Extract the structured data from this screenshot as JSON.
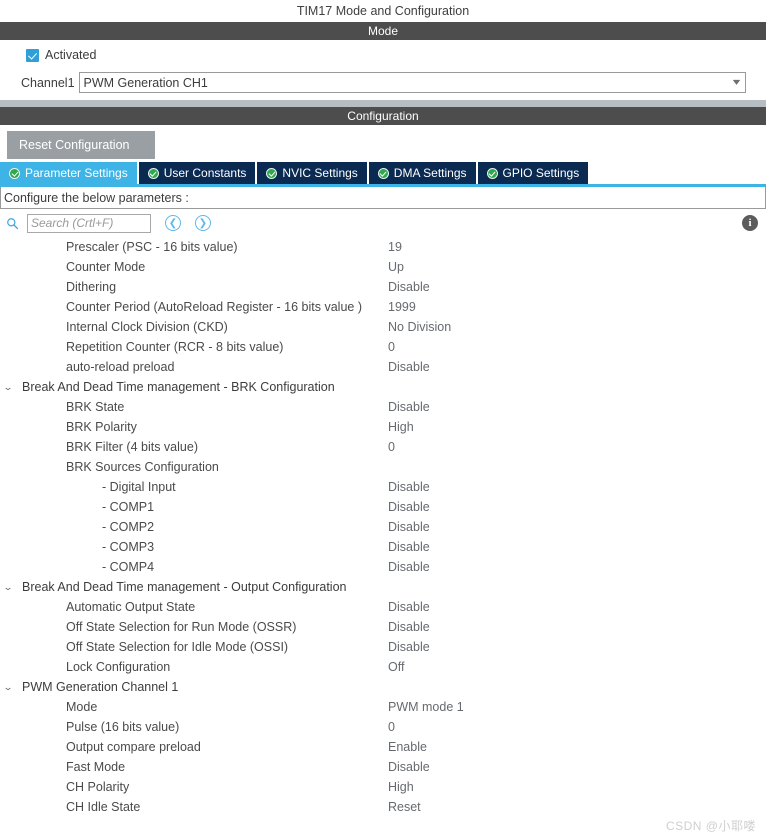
{
  "window": {
    "title": "TIM17 Mode and Configuration"
  },
  "mode_section": {
    "header": "Mode",
    "activated_label": "Activated",
    "activated_checked": true,
    "channel_label": "Channel1",
    "channel_value": "PWM Generation CH1",
    "dropdown_icon": "chevron-down-icon"
  },
  "configuration_section": {
    "header": "Configuration",
    "reset_button": "Reset Configuration",
    "tabs": [
      {
        "label": "Parameter Settings",
        "icon": "check-circle-icon",
        "active": true
      },
      {
        "label": "User Constants",
        "icon": "check-circle-icon",
        "active": false
      },
      {
        "label": "NVIC Settings",
        "icon": "check-circle-icon",
        "active": false
      },
      {
        "label": "DMA Settings",
        "icon": "check-circle-icon",
        "active": false
      },
      {
        "label": "GPIO Settings",
        "icon": "check-circle-icon",
        "active": false
      }
    ],
    "configure_prompt": "Configure the below parameters :",
    "search": {
      "icon": "search-icon",
      "placeholder": "Search (Crtl+F)",
      "value": "",
      "prev_icon": "chevron-left-circle-icon",
      "next_icon": "chevron-right-circle-icon"
    },
    "info_icon": "info-icon",
    "info_icon_label": "i"
  },
  "parameters": [
    {
      "type": "param",
      "indent": 1,
      "name": "Prescaler (PSC - 16 bits value)",
      "value": "19"
    },
    {
      "type": "param",
      "indent": 1,
      "name": "Counter Mode",
      "value": "Up"
    },
    {
      "type": "param",
      "indent": 1,
      "name": "Dithering",
      "value": "Disable"
    },
    {
      "type": "param",
      "indent": 1,
      "name": "Counter Period (AutoReload Register - 16 bits value )",
      "value": "1999"
    },
    {
      "type": "param",
      "indent": 1,
      "name": "Internal Clock Division (CKD)",
      "value": "No Division"
    },
    {
      "type": "param",
      "indent": 1,
      "name": "Repetition Counter (RCR - 8 bits value)",
      "value": "0"
    },
    {
      "type": "param",
      "indent": 1,
      "name": "auto-reload preload",
      "value": "Disable"
    },
    {
      "type": "group",
      "indent": 0,
      "name": "Break And Dead Time management - BRK Configuration",
      "value": "",
      "expanded": true
    },
    {
      "type": "param",
      "indent": 1,
      "name": "BRK State",
      "value": "Disable"
    },
    {
      "type": "param",
      "indent": 1,
      "name": "BRK Polarity",
      "value": "High"
    },
    {
      "type": "param",
      "indent": 1,
      "name": "BRK Filter (4 bits value)",
      "value": "0"
    },
    {
      "type": "param",
      "indent": 1,
      "name": "BRK Sources Configuration",
      "value": ""
    },
    {
      "type": "param",
      "indent": 2,
      "name": "- Digital Input",
      "value": "Disable"
    },
    {
      "type": "param",
      "indent": 2,
      "name": "- COMP1",
      "value": "Disable"
    },
    {
      "type": "param",
      "indent": 2,
      "name": "- COMP2",
      "value": "Disable"
    },
    {
      "type": "param",
      "indent": 2,
      "name": "- COMP3",
      "value": "Disable"
    },
    {
      "type": "param",
      "indent": 2,
      "name": "- COMP4",
      "value": "Disable"
    },
    {
      "type": "group",
      "indent": 0,
      "name": "Break And Dead Time management - Output Configuration",
      "value": "",
      "expanded": true
    },
    {
      "type": "param",
      "indent": 1,
      "name": "Automatic Output State",
      "value": "Disable"
    },
    {
      "type": "param",
      "indent": 1,
      "name": "Off State Selection for Run Mode (OSSR)",
      "value": "Disable"
    },
    {
      "type": "param",
      "indent": 1,
      "name": "Off State Selection for Idle Mode (OSSI)",
      "value": "Disable"
    },
    {
      "type": "param",
      "indent": 1,
      "name": "Lock Configuration",
      "value": "Off"
    },
    {
      "type": "group",
      "indent": 0,
      "name": "PWM Generation Channel 1",
      "value": "",
      "expanded": true
    },
    {
      "type": "param",
      "indent": 1,
      "name": "Mode",
      "value": "PWM mode 1"
    },
    {
      "type": "param",
      "indent": 1,
      "name": "Pulse (16 bits value)",
      "value": "0"
    },
    {
      "type": "param",
      "indent": 1,
      "name": "Output compare preload",
      "value": "Enable"
    },
    {
      "type": "param",
      "indent": 1,
      "name": "Fast Mode",
      "value": "Disable"
    },
    {
      "type": "param",
      "indent": 1,
      "name": "CH Polarity",
      "value": "High"
    },
    {
      "type": "param",
      "indent": 1,
      "name": "CH Idle State",
      "value": "Reset"
    }
  ],
  "watermark": "CSDN @小耶喽",
  "colors": {
    "section_header_bg": "#4d4d4d",
    "accent_blue": "#3eb4e6",
    "tab_inactive_bg": "#0b2a52",
    "checkbox_blue": "#2f9fd8",
    "check_green": "#2fa84f",
    "spacer_gray": "#b6bec4",
    "reset_button_bg": "#999fa3"
  }
}
